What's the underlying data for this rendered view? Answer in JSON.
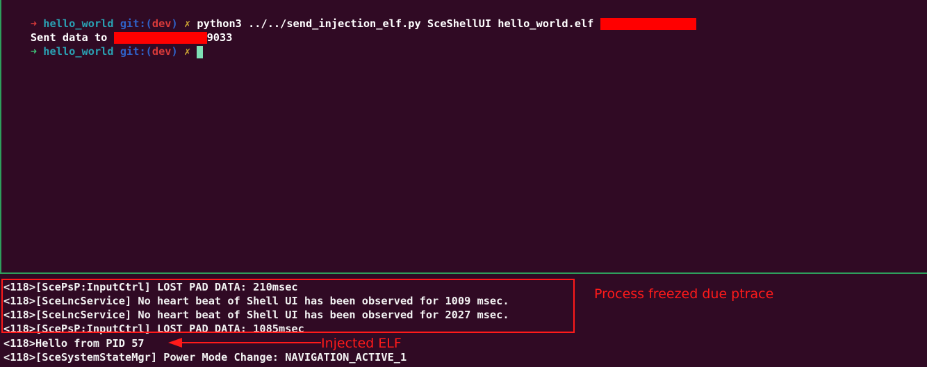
{
  "top_pane": {
    "prompt_arrow": "➜",
    "dir": "hello_world",
    "git_label": "git:(",
    "branch": "dev",
    "git_close": ")",
    "dirty_mark": "✗",
    "command": "python3 ../../send_injection_elf.py SceShellUI hello_world.elf",
    "sent_prefix": "Sent data to",
    "sent_suffix": "9033"
  },
  "bottom_pane": {
    "log_lines": [
      "<118>[ScePsP:InputCtrl] LOST PAD DATA: 210msec",
      "<118>[SceLncService] No heart beat of Shell UI has been observed for 1009 msec.",
      "<118>[SceLncService] No heart beat of Shell UI has been observed for 2027 msec.",
      "<118>[ScePsP:InputCtrl] LOST PAD DATA: 1085msec",
      "<118>Hello from PID 57",
      "<118>[SceSystemStateMgr] Power Mode Change: NAVIGATION_ACTIVE_1"
    ]
  },
  "annotations": {
    "box_label": "Process freezed due ptrace",
    "arrow_label": "Injected ELF"
  },
  "colors": {
    "background": "#300a24",
    "divider": "#2e9e5c",
    "annotation": "#ff1a1a"
  }
}
